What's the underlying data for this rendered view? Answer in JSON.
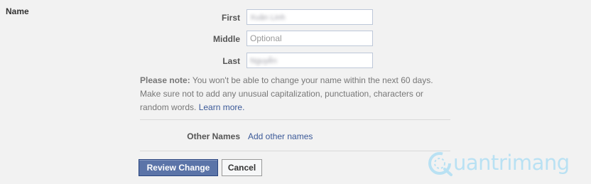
{
  "section": {
    "title": "Name"
  },
  "fields": {
    "first": {
      "label": "First",
      "value": "Xuân Linh"
    },
    "middle": {
      "label": "Middle",
      "placeholder": "Optional",
      "value": ""
    },
    "last": {
      "label": "Last",
      "value": "Nguyễn"
    }
  },
  "note": {
    "bold": "Please note:",
    "text": " You won't be able to change your name within the next 60 days. Make sure not to add any unusual capitalization, punctuation, characters or random words. ",
    "link": "Learn more."
  },
  "other_names": {
    "label": "Other Names",
    "link": "Add other names"
  },
  "actions": {
    "review": "Review Change",
    "cancel": "Cancel"
  },
  "watermark": {
    "text": "uantrimang"
  },
  "colors": {
    "link": "#3b5998",
    "primary_button": "#5b74a8",
    "background": "#f2f2f2"
  }
}
